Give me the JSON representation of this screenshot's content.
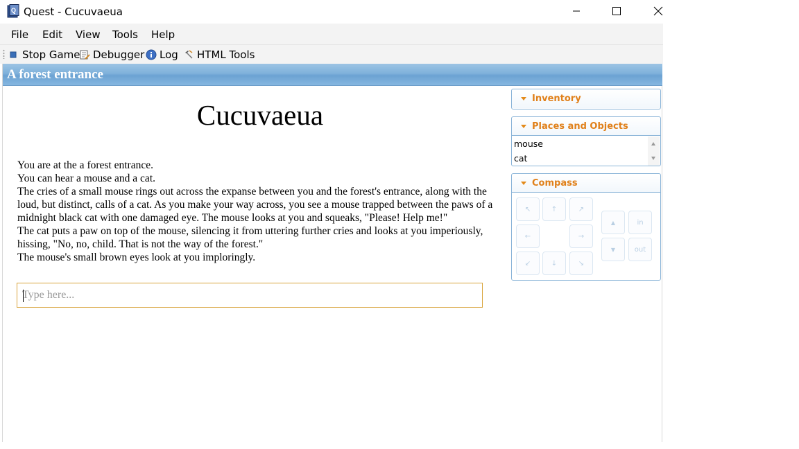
{
  "window": {
    "title": "Quest - Cucuvaeua",
    "minimize_glyph": "─",
    "maximize_glyph": "☐",
    "close_glyph": "✕"
  },
  "menu": [
    "File",
    "Edit",
    "View",
    "Tools",
    "Help"
  ],
  "toolbar": {
    "stop_game": "Stop Game",
    "debugger": "Debugger",
    "log": "Log",
    "html_tools": "HTML Tools"
  },
  "location": {
    "name": "A forest entrance"
  },
  "game": {
    "title": "Cucuvaeua",
    "output": [
      "You are at the a forest entrance.",
      "You can hear a mouse and a cat.",
      "The cries of a small mouse rings out across the expanse between you and the forest's entrance, along with the loud, but distinct, calls of a cat. As you make your way across, you see a mouse trapped between the paws of a midnight black cat with one damaged eye. The mouse looks at you and squeaks, \"Please! Help me!\"",
      "The cat puts a paw on top of the mouse, silencing it from uttering further cries and looks at you imperiously, hissing, \"No, no, child. That is not the way of the forest.\"",
      "The mouse's small brown eyes look at you imploringly."
    ],
    "command_placeholder": "Type here..."
  },
  "panels": {
    "inventory": {
      "title": "Inventory"
    },
    "places": {
      "title": "Places and Objects",
      "items": [
        "mouse",
        "cat"
      ]
    },
    "compass": {
      "title": "Compass",
      "buttons": {
        "nw": "↖",
        "n": "↑",
        "ne": "↗",
        "w": "←",
        "e": "→",
        "sw": "↙",
        "s": "↓",
        "se": "↘",
        "up": "▲",
        "down": "▼",
        "in": "in",
        "out": "out"
      }
    }
  },
  "colors": {
    "location_bar": "#7fb1db",
    "panel_border": "#8ab4d8",
    "panel_title": "#e0801a",
    "input_border": "#d8a33a"
  },
  "icons": {
    "app": "quest-app-icon",
    "stop": "stop-icon",
    "debugger": "debugger-icon",
    "log": "info-icon",
    "html_tools": "html-tools-icon"
  }
}
